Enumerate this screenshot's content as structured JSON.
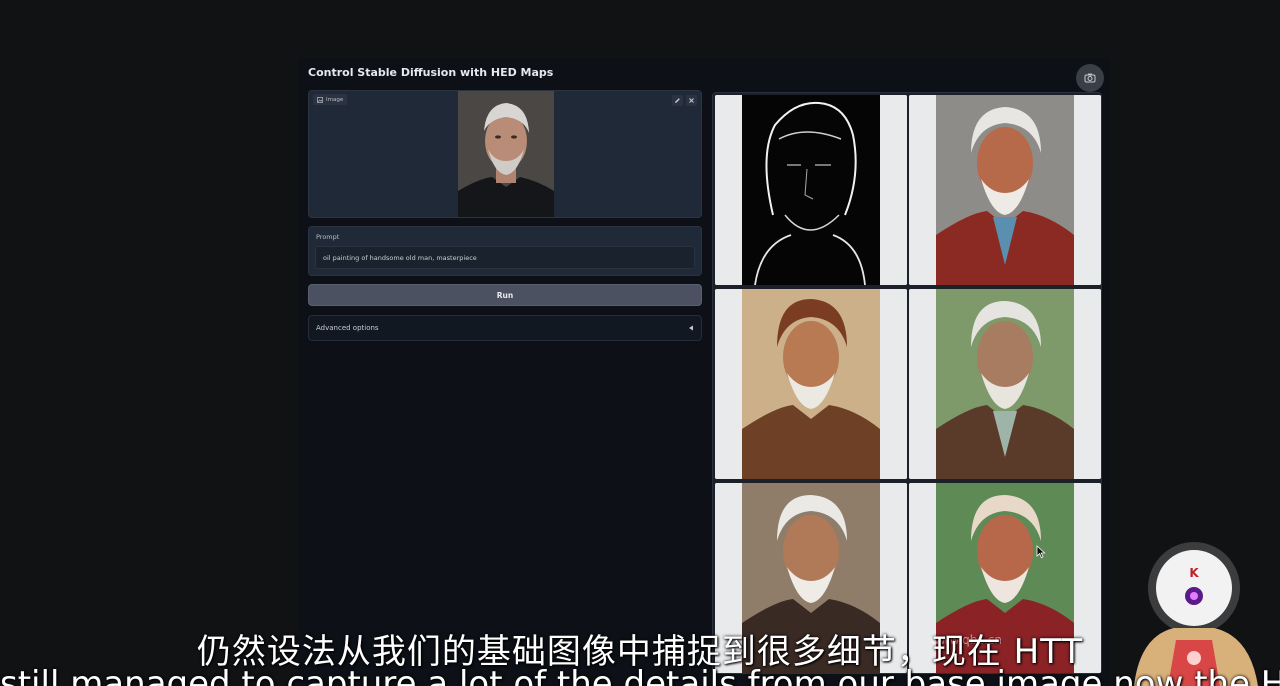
{
  "app": {
    "title": "Control Stable Diffusion with HED Maps"
  },
  "image_input": {
    "label": "Image"
  },
  "prompt": {
    "label": "Prompt",
    "value": "oil painting of handsome old man, masterpiece"
  },
  "run": {
    "label": "Run"
  },
  "advanced": {
    "label": "Advanced options",
    "icon": "triangle-left-icon"
  },
  "gallery": {
    "items": [
      "hed-map",
      "output-1",
      "output-2",
      "output-3",
      "output-4",
      "output-5"
    ]
  },
  "overlay": {
    "subtitle_cn": "仍然设法从我们的基础图像中捕捉到很多细节，现在 HTT",
    "subtitle_en": "still managed to capture a lot of the details from our base image now the HTT",
    "watermark": "www.qbc.cn",
    "mascot_letter": "K"
  },
  "colors": {
    "panel": "#1f2937",
    "background": "#0d1117",
    "button": "#4b5160"
  }
}
